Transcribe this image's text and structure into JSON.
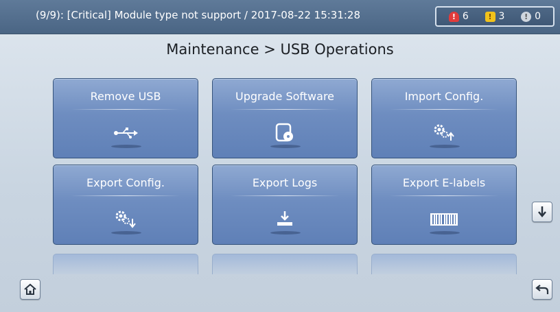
{
  "alarm_bar": {
    "text": "(9/9): [Critical] Module type not support / 2017-08-22 15:31:28",
    "counts": {
      "critical": "6",
      "major": "3",
      "minor": "0"
    }
  },
  "page": {
    "title": "Maintenance > USB Operations"
  },
  "tiles": [
    {
      "label": "Remove USB",
      "icon": "usb-icon"
    },
    {
      "label": "Upgrade Software",
      "icon": "software-disk-icon"
    },
    {
      "label": "Import Config.",
      "icon": "gear-import-icon"
    },
    {
      "label": "Export Config.",
      "icon": "gear-export-icon"
    },
    {
      "label": "Export Logs",
      "icon": "download-log-icon"
    },
    {
      "label": "Export E-labels",
      "icon": "barcode-icon"
    }
  ],
  "nav": {
    "scroll_down": "arrow-down-icon",
    "home": "home-icon",
    "back": "back-icon"
  },
  "colors": {
    "tile": "#6e8dc0",
    "topbar": "#4a6584",
    "critical": "#e23b3b",
    "major": "#f1c21b"
  }
}
